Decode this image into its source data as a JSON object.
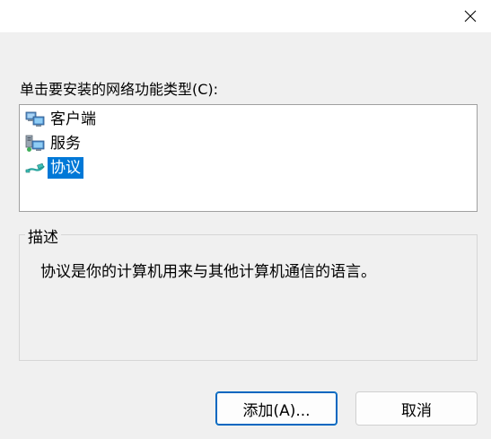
{
  "window": {
    "close_icon": "close-icon"
  },
  "prompt": {
    "label": "单击要安装的网络功能类型(C):"
  },
  "feature_list": {
    "items": [
      {
        "label": "客户端",
        "icon": "client-computer-icon",
        "selected": false
      },
      {
        "label": "服务",
        "icon": "service-computer-icon",
        "selected": false
      },
      {
        "label": "协议",
        "icon": "protocol-cable-icon",
        "selected": true
      }
    ]
  },
  "description_group": {
    "title": "描述",
    "text": "协议是你的计算机用来与其他计算机通信的语言。"
  },
  "buttons": {
    "add_label": "添加(A)...",
    "cancel_label": "取消"
  },
  "colors": {
    "selection": "#0078d7",
    "primary_border": "#0067c0",
    "background": "#f0f0f0"
  }
}
